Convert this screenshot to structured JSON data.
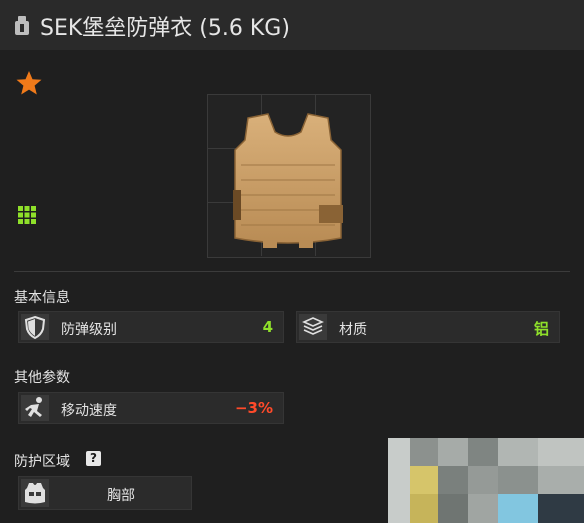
{
  "window": {
    "title": "SEK堡垒防弹衣 (5.6 KG)",
    "title_icon": "armor-weight-icon"
  },
  "item": {
    "favorite_icon": "star-icon",
    "favorite_color": "#f07a1a",
    "size_icon": "grid-size-icon",
    "size_color": "#8fe02a",
    "image": "body-armor-vest"
  },
  "sections": {
    "basic": {
      "title": "基本信息",
      "stats": [
        {
          "icon": "shield-icon",
          "label": "防弹级别",
          "value": "4",
          "value_color": "#8fe02a"
        },
        {
          "icon": "material-plates-icon",
          "label": "材质",
          "value": "铝",
          "value_color": "#8fe02a"
        }
      ]
    },
    "other": {
      "title": "其他参数",
      "stats": [
        {
          "icon": "running-person-icon",
          "label": "移动速度",
          "value": "−3%",
          "value_color": "#ff4a2a"
        }
      ]
    },
    "protection": {
      "title": "防护区域",
      "help_label": "?",
      "zones": [
        {
          "icon": "chest-armor-icon",
          "label": "胸部"
        }
      ]
    }
  }
}
